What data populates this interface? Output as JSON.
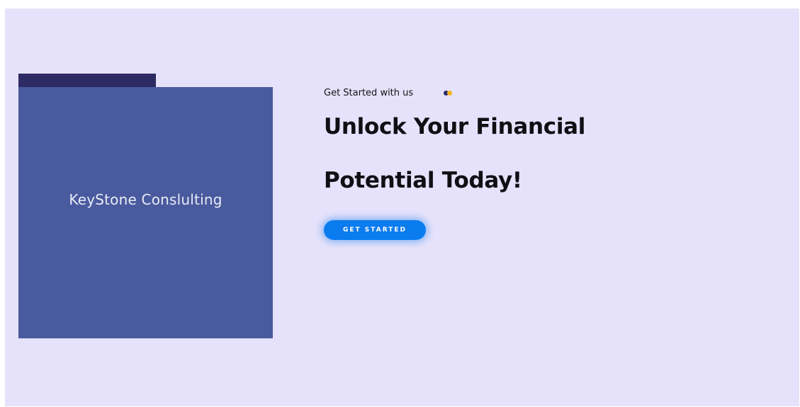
{
  "brand": {
    "name": "KeyStone Conslulting"
  },
  "hero": {
    "eyebrow": "Get Started with us",
    "headline_line1": "Unlock Your Financial",
    "headline_line2": "Potential Today!",
    "cta_label": "GET STARTED"
  },
  "icons": {
    "eyebrow_icon": "two-dots-icon"
  },
  "colors": {
    "background": "#e6e2fb",
    "brand_card": "#495b9e",
    "brand_tab": "#2d2a64",
    "cta": "#0b7cf0",
    "accent_dot": "#f2b51a"
  }
}
